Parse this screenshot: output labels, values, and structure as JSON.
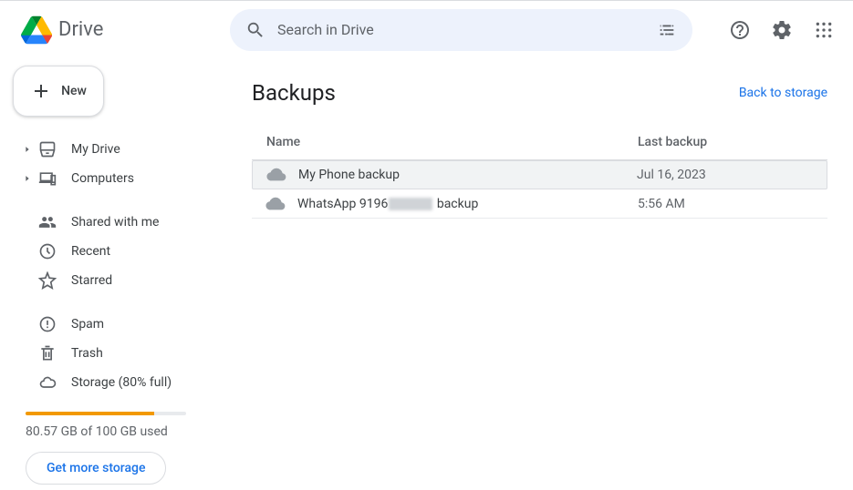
{
  "app": {
    "name": "Drive"
  },
  "search": {
    "placeholder": "Search in Drive"
  },
  "newButton": {
    "label": "New"
  },
  "nav": {
    "myDrive": "My Drive",
    "computers": "Computers",
    "shared": "Shared with me",
    "recent": "Recent",
    "starred": "Starred",
    "spam": "Spam",
    "trash": "Trash",
    "storage": "Storage (80% full)"
  },
  "storage": {
    "percent": 80,
    "usage": "80.57 GB of 100 GB used",
    "cta": "Get more storage"
  },
  "page": {
    "title": "Backups",
    "backLink": "Back to storage"
  },
  "table": {
    "headers": {
      "name": "Name",
      "date": "Last backup"
    },
    "rows": [
      {
        "name_prefix": "My Phone backup",
        "name_suffix": "",
        "redacted": false,
        "date": "Jul 16, 2023",
        "selected": true
      },
      {
        "name_prefix": "WhatsApp 9196",
        "name_suffix": " backup",
        "redacted": true,
        "date": "5:56 AM",
        "selected": false
      }
    ]
  }
}
